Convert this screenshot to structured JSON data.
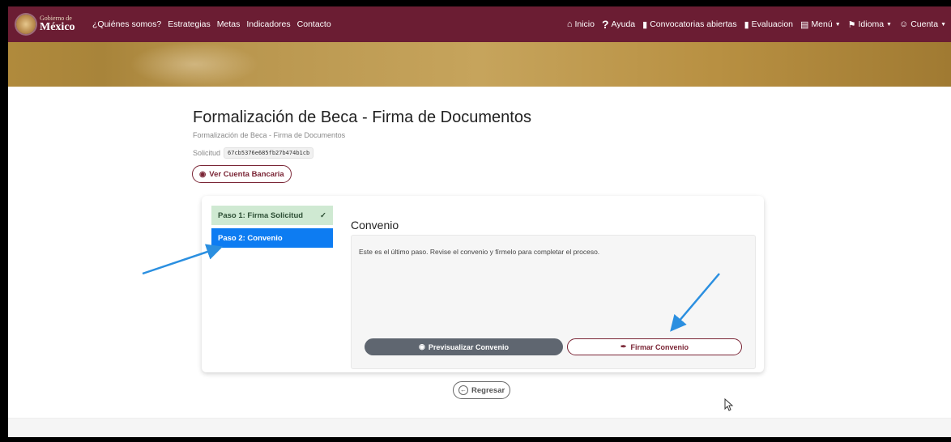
{
  "navbar": {
    "logo_small": "Gobierno de",
    "logo_big": "México",
    "left_links": [
      "¿Quiénes somos?",
      "Estrategias",
      "Metas",
      "Indicadores",
      "Contacto"
    ],
    "right_items": {
      "inicio": "Inicio",
      "ayuda": "Ayuda",
      "convocatorias": "Convocatorias abiertas",
      "evaluacion": "Evaluacion",
      "menu": "Menú",
      "idioma": "Idioma",
      "cuenta": "Cuenta"
    }
  },
  "page": {
    "title": "Formalización de Beca - Firma de Documentos",
    "subtitle": "Formalización de Beca - Firma de Documentos",
    "solicitud_label": "Solicitud",
    "solicitud_id": "67cb5376e685fb27b474b1cb",
    "ver_cuenta_label": "Ver Cuenta Bancaria"
  },
  "steps": [
    {
      "label": "Paso 1: Firma Solicitud",
      "status": "done"
    },
    {
      "label": "Paso 2: Convenio",
      "status": "active"
    }
  ],
  "convenio": {
    "title": "Convenio",
    "text": "Este es el último paso. Revise el convenio y fírmelo para completar el proceso.",
    "preview_label": "Previsualizar Convenio",
    "sign_label": "Firmar Convenio"
  },
  "regresar_label": "Regresar",
  "colors": {
    "navbar": "#6b1d33",
    "accent": "#7a2535",
    "step_done": "#cfe9d2",
    "step_active": "#0d7cf2",
    "annotation_arrow": "#2b8fe0"
  }
}
